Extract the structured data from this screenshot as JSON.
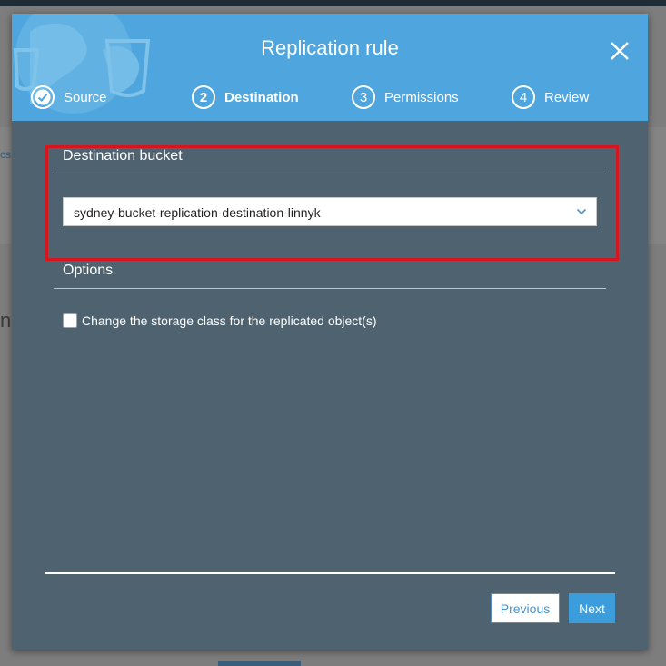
{
  "background": {
    "tab_fragment": "cs",
    "text_fragment": "na"
  },
  "modal": {
    "title": "Replication rule",
    "close_icon": "close-icon",
    "steps": [
      {
        "number": "1",
        "label": "Source",
        "state": "completed",
        "icon": "check-circle-icon"
      },
      {
        "number": "2",
        "label": "Destination",
        "state": "active"
      },
      {
        "number": "3",
        "label": "Permissions",
        "state": "pending"
      },
      {
        "number": "4",
        "label": "Review",
        "state": "pending"
      }
    ],
    "destination": {
      "heading": "Destination bucket",
      "selected_bucket": "sydney-bucket-replication-destination-linnyk",
      "dropdown_icon": "chevron-down-icon"
    },
    "options": {
      "heading": "Options",
      "storage_class_label": "Change the storage class for the replicated object(s)",
      "storage_class_checked": false
    },
    "footer": {
      "previous_label": "Previous",
      "next_label": "Next"
    }
  },
  "colors": {
    "header": "#4fa6de",
    "body": "#4f6270",
    "highlight": "#d4161e",
    "primary_button": "#3c9ddd"
  }
}
